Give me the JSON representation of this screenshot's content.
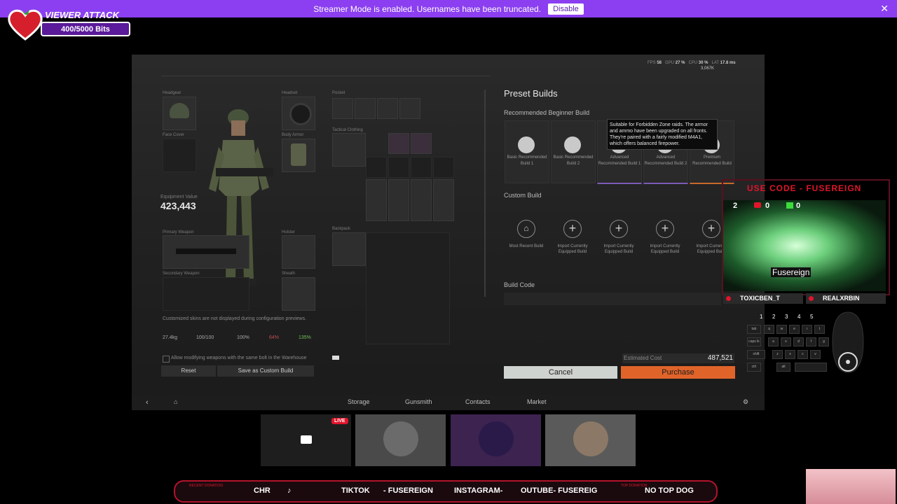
{
  "banner": {
    "message": "Streamer Mode is enabled. Usernames have been truncated.",
    "disable_label": "Disable"
  },
  "viewer_attack": {
    "title": "VIEWER ATTACK",
    "progress": "400/5000 Bits"
  },
  "game": {
    "stats": {
      "fps_label": "FPS",
      "fps": "58",
      "gpu_label": "GPU",
      "gpu": "27 %",
      "cpu_label": "CPU",
      "cpu": "30 %",
      "lat_label": "LAT",
      "lat": "17.8 ms",
      "credits": "3,067K"
    },
    "labels": {
      "headgear": "Headgear",
      "headset": "Headset",
      "face_cover": "Face Cover",
      "body_armor": "Body Armor",
      "pocket": "Pocket",
      "tactical": "Tactical Clothing",
      "backpack": "Backpack",
      "primary": "Primary Weapon",
      "secondary": "Secondary Weapon",
      "holster": "Holster",
      "sheath": "Sheath"
    },
    "equipment_value_label": "Equipment Value",
    "equipment_value": "423,443",
    "skin_notice": "Customized skins are not displayed during configuration previews.",
    "stats_row": {
      "weight": "27.4kg",
      "durability": "100/100",
      "pen": "100%",
      "heat": "64%",
      "speed": "135%"
    },
    "allow_modify": "Allow modifying weapons with the same bolt in the Warehouse",
    "reset_label": "Reset",
    "save_custom_label": "Save as Custom Build",
    "preset_title": "Preset Builds",
    "beginner_title": "Recommended Beginner Build",
    "presets": [
      {
        "label": "Basic Recommended Build 1"
      },
      {
        "label": "Basic Recommended Build 2"
      },
      {
        "label": "Advanced Recommended Build 1"
      },
      {
        "label": "Advanced Recommended Build 2"
      },
      {
        "label": "Premium Recommended Build"
      }
    ],
    "tooltip": "Suitable for Forbidden Zone raids. The armor and ammo have been upgraded on all fronts. They're paired with a fairly modified M4A1, which offers balanced firepower.",
    "custom_title": "Custom Build",
    "customs": [
      {
        "label": "Most Recent Build"
      },
      {
        "label": "Import Currently Equipped Build"
      },
      {
        "label": "Import Currently Equipped Build"
      },
      {
        "label": "Import Currently Equipped Build"
      },
      {
        "label": "Import Currently Equipped Build"
      }
    ],
    "build_code_label": "Build Code",
    "estimated_cost_label": "Estimated Cost",
    "estimated_cost": "487,521",
    "cancel_label": "Cancel",
    "purchase_label": "Purchase",
    "nav": {
      "storage": "Storage",
      "gunsmith": "Gunsmith",
      "contacts": "Contacts",
      "market": "Market"
    }
  },
  "overlay": {
    "use_code": "USE CODE - FUSEREIGN",
    "counters": {
      "twitch": "2",
      "youtube": "0",
      "kick": "0"
    },
    "cam_name": "Fusereign",
    "name_left": "TOXICBEN_T",
    "name_right": "REALXRBIN",
    "keys_numbers": [
      "1",
      "2",
      "3",
      "4",
      "5"
    ],
    "keys": {
      "tab": "tab",
      "q": "q",
      "w": "w",
      "e": "e",
      "r": "r",
      "t": "t",
      "caps": "caps lk",
      "a": "a",
      "s": "s",
      "d": "d",
      "f": "f",
      "g": "g",
      "shift": "shift",
      "z": "z",
      "x": "x",
      "c": "c",
      "v": "v",
      "ctrl": "ctrl",
      "alt": "alt"
    },
    "live_badge": "LIVE"
  },
  "ticker": {
    "recent_label": "RECENT DONATION",
    "recent_value": "CHR",
    "tiktok": "TIKTOK",
    "fusereign": "- FUSEREIGN",
    "instagram": "INSTAGRAM-",
    "youtube": "OUTUBE- FUSEREIG",
    "top_label": "TOP DONATION",
    "top_value": "NO TOP DOG"
  },
  "colors": {
    "accent": "#e0642a",
    "banner": "#8b3ff0",
    "brand_red": "#e0142c"
  }
}
